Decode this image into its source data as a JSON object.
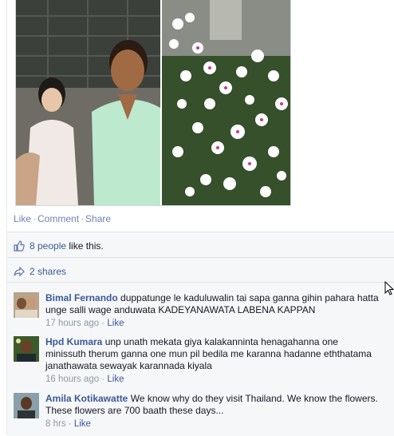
{
  "post": {
    "actions": {
      "like": "Like",
      "comment": "Comment",
      "share": "Share"
    }
  },
  "ufi": {
    "likes_link": "8 people",
    "likes_suffix": " like this.",
    "shares": "2 shares"
  },
  "comments": [
    {
      "author": "Bimal Fernando",
      "text": "duppatunge le kaduluwalin tai sapa ganna gihin pahara hatta unge salli wage anduwata KADEYANAWATA LABENA KAPPAN",
      "time": "17 hours ago",
      "like": "Like"
    },
    {
      "author": "Hpd Kumara",
      "text": "unp unath mekata giya kalakanninta henagahanna one minissuth therum ganna one mun pil bedila me karanna hadanne eththatama janathawata sewayak karannada kiyala",
      "time": "16 hours ago",
      "like": "Like"
    },
    {
      "author": "Amila Kotikawatte",
      "text": "We know why do they visit Thailand. We know the flowers. These flowers are 700 baath these days...",
      "time": "8 hrs",
      "like": "Like"
    }
  ],
  "icons": {
    "like": "thumbs-up-icon",
    "share": "share-arrow-icon",
    "cursor": "mouse-pointer-icon"
  },
  "colors": {
    "link": "#3b5998",
    "muted": "#9197a3",
    "ufi_bg": "#f6f7f8"
  }
}
